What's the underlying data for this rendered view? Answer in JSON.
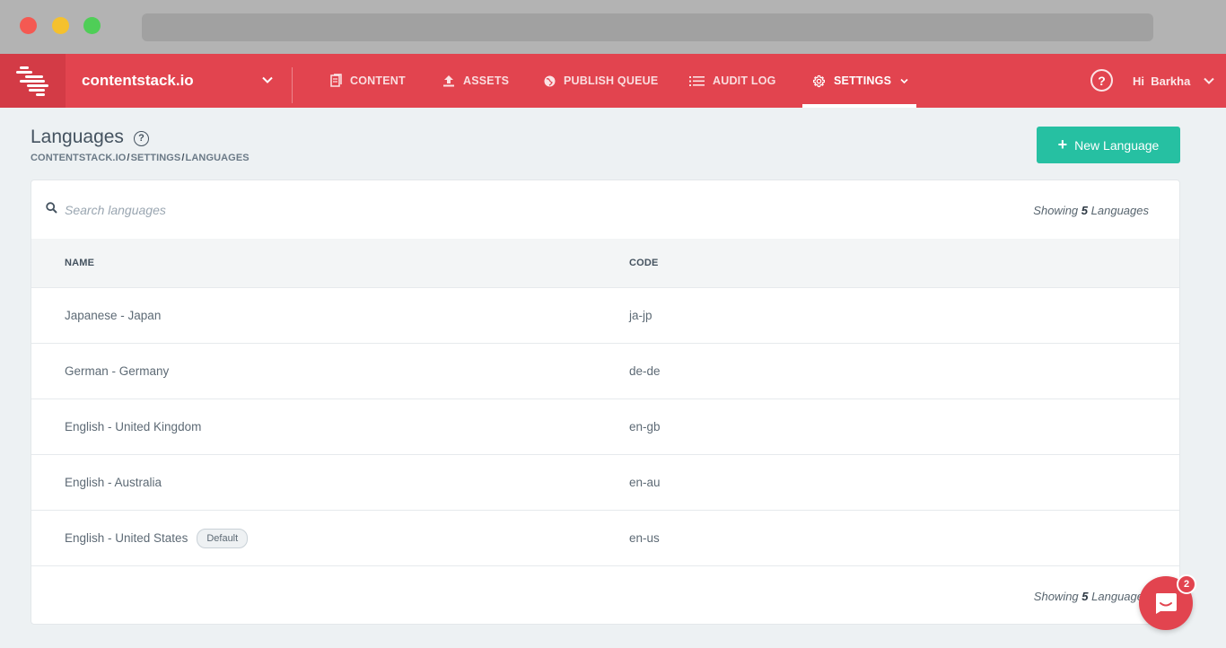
{
  "nav": {
    "stack_name": "contentstack.io",
    "items": [
      {
        "label": "CONTENT",
        "icon": "document-icon"
      },
      {
        "label": "ASSETS",
        "icon": "upload-icon"
      },
      {
        "label": "PUBLISH QUEUE",
        "icon": "globe-icon"
      },
      {
        "label": "AUDIT LOG",
        "icon": "list-icon"
      },
      {
        "label": "SETTINGS",
        "icon": "gear-icon",
        "active": true
      }
    ],
    "help_label": "?",
    "user_greeting": "Hi  Barkha"
  },
  "page": {
    "title": "Languages",
    "breadcrumb": [
      "CONTENTSTACK.IO",
      "SETTINGS",
      "LANGUAGES"
    ],
    "new_button": "New Language"
  },
  "search": {
    "placeholder": "Search languages"
  },
  "count": {
    "prefix": "Showing",
    "number": "5",
    "suffix": "Languages",
    "suffix_bottom": "Language"
  },
  "table": {
    "headers": {
      "name": "NAME",
      "code": "CODE"
    },
    "rows": [
      {
        "name": "Japanese - Japan",
        "code": "ja-jp"
      },
      {
        "name": "German - Germany",
        "code": "de-de"
      },
      {
        "name": "English - United Kingdom",
        "code": "en-gb"
      },
      {
        "name": "English - Australia",
        "code": "en-au"
      },
      {
        "name": "English - United States",
        "code": "en-us",
        "badge": "Default"
      }
    ]
  },
  "chat": {
    "badge_count": "2"
  },
  "colors": {
    "brand": "#e2444f",
    "primary_button": "#26c0a2"
  }
}
